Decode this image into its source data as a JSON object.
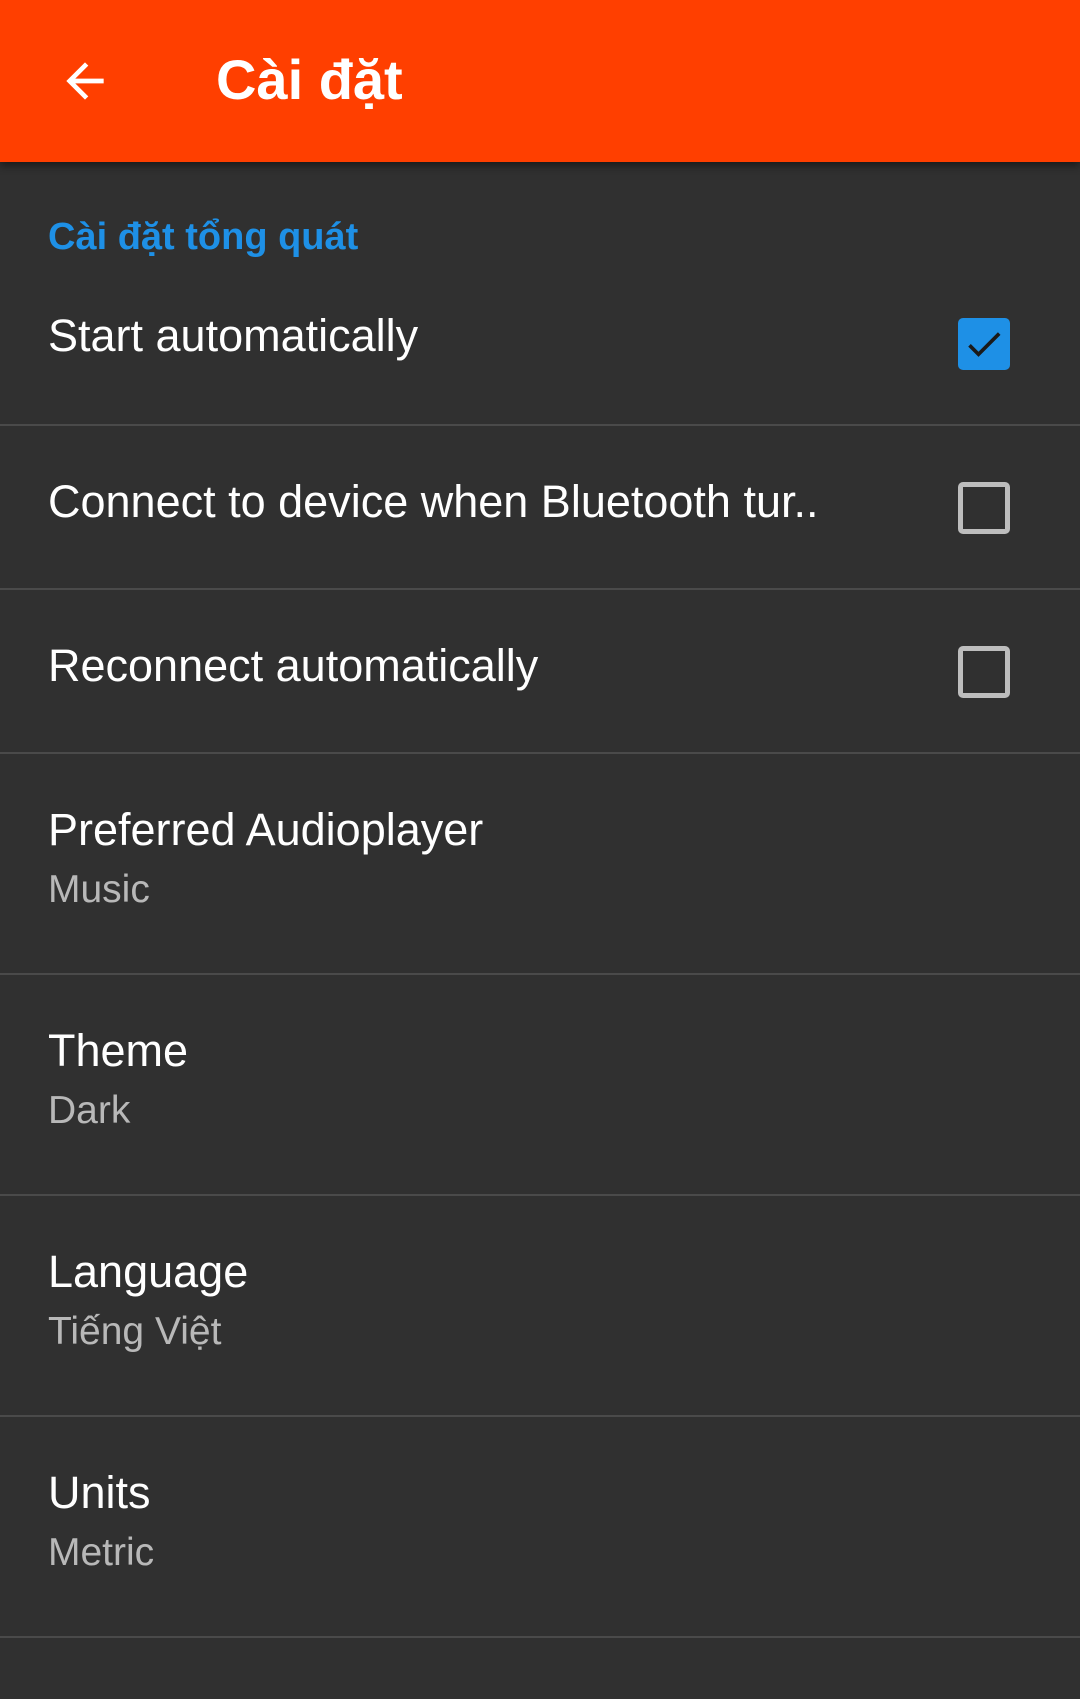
{
  "app_bar": {
    "title": "Cài đặt",
    "back_icon": "arrow-back-icon",
    "color": "#ff3f00"
  },
  "section": {
    "header": "Cài đặt tổng quát",
    "header_color": "#1e90e6"
  },
  "checkbox_prefs": [
    {
      "title": "Start automatically",
      "checked": true
    },
    {
      "title": "Connect to device when Bluetooth tur..",
      "checked": false
    },
    {
      "title": "Reconnect automatically",
      "checked": false
    }
  ],
  "list_prefs": [
    {
      "title": "Preferred Audioplayer",
      "summary": "Music"
    },
    {
      "title": "Theme",
      "summary": "Dark"
    },
    {
      "title": "Language",
      "summary": "Tiếng Việt"
    },
    {
      "title": "Units",
      "summary": "Metric"
    }
  ],
  "colors": {
    "background": "#303030",
    "divider": "#4a4a4a",
    "checkbox_accent": "#1e90e6"
  }
}
